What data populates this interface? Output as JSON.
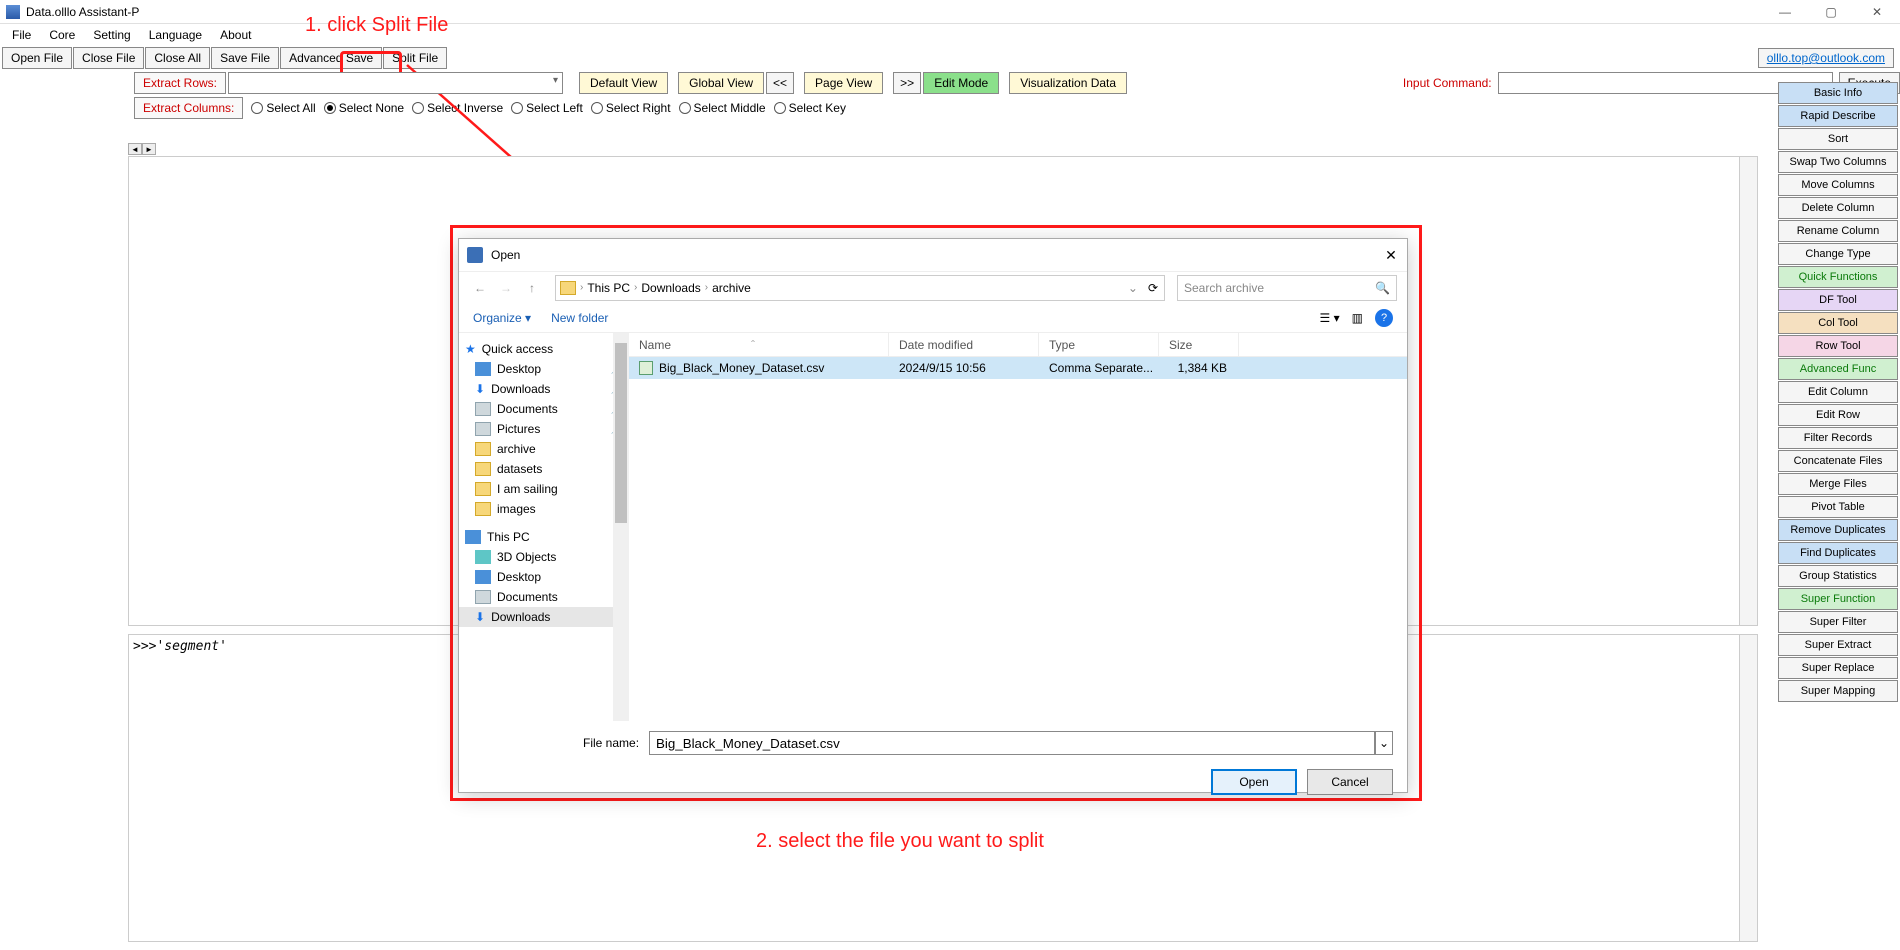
{
  "window": {
    "title": "Data.olllo Assistant-P"
  },
  "menu": {
    "file": "File",
    "core": "Core",
    "setting": "Setting",
    "language": "Language",
    "about": "About"
  },
  "toolbar": {
    "open": "Open File",
    "close": "Close File",
    "closeall": "Close All",
    "save": "Save File",
    "advsave": "Advanced Save",
    "split": "Split File"
  },
  "userlink": "olllo.top@outlook.com",
  "row2": {
    "extract_rows": "Extract Rows:",
    "default_view": "Default View",
    "global_view": "Global View",
    "prev": "<<",
    "page_view": "Page View",
    "next": ">>",
    "edit_mode": "Edit Mode",
    "viz": "Visualization Data",
    "input_cmd": "Input Command:",
    "execute": "Execute"
  },
  "row3": {
    "extract_cols": "Extract Columns:",
    "all": "Select All",
    "none": "Select None",
    "inv": "Select Inverse",
    "left": "Select Left",
    "right": "Select Right",
    "mid": "Select Middle",
    "key": "Select Key"
  },
  "sidebar": [
    {
      "label": "Basic Info",
      "cls": "c-blue"
    },
    {
      "label": "Rapid Describe",
      "cls": "c-blue"
    },
    {
      "label": "Sort",
      "cls": "c-def"
    },
    {
      "label": "Swap Two Columns",
      "cls": "c-def"
    },
    {
      "label": "Move Columns",
      "cls": "c-def"
    },
    {
      "label": "Delete Column",
      "cls": "c-def"
    },
    {
      "label": "Rename Column",
      "cls": "c-def"
    },
    {
      "label": "Change Type",
      "cls": "c-def"
    },
    {
      "label": "Quick Functions",
      "cls": "c-green"
    },
    {
      "label": "DF Tool",
      "cls": "c-purple"
    },
    {
      "label": "Col Tool",
      "cls": "c-orange"
    },
    {
      "label": "Row Tool",
      "cls": "c-pink"
    },
    {
      "label": "Advanced Func",
      "cls": "c-green"
    },
    {
      "label": "Edit Column",
      "cls": "c-def"
    },
    {
      "label": "Edit Row",
      "cls": "c-def"
    },
    {
      "label": "Filter Records",
      "cls": "c-def"
    },
    {
      "label": "Concatenate Files",
      "cls": "c-def"
    },
    {
      "label": "Merge Files",
      "cls": "c-def"
    },
    {
      "label": "Pivot Table",
      "cls": "c-def"
    },
    {
      "label": "Remove Duplicates",
      "cls": "c-blue"
    },
    {
      "label": "Find Duplicates",
      "cls": "c-blue"
    },
    {
      "label": "Group Statistics",
      "cls": "c-def"
    },
    {
      "label": "Super Function",
      "cls": "c-green"
    },
    {
      "label": "Super Filter",
      "cls": "c-def"
    },
    {
      "label": "Super Extract",
      "cls": "c-def"
    },
    {
      "label": "Super Replace",
      "cls": "c-def"
    },
    {
      "label": "Super Mapping",
      "cls": "c-def"
    }
  ],
  "console": ">>>'segment'",
  "anno": {
    "step1": "1. click Split File",
    "step2": "2. select the file you want to split"
  },
  "dialog": {
    "title": "Open",
    "path": {
      "root": "This PC",
      "p1": "Downloads",
      "p2": "archive"
    },
    "search_placeholder": "Search archive",
    "organize": "Organize",
    "newfolder": "New folder",
    "cols": {
      "name": "Name",
      "date": "Date modified",
      "type": "Type",
      "size": "Size"
    },
    "file": {
      "name": "Big_Black_Money_Dataset.csv",
      "date": "2024/9/15 10:56",
      "type": "Comma Separate...",
      "size": "1,384 KB"
    },
    "nav": {
      "quick": "Quick access",
      "desktop": "Desktop",
      "downloads": "Downloads",
      "documents": "Documents",
      "pictures": "Pictures",
      "archive": "archive",
      "datasets": "datasets",
      "sailing": "I am sailing",
      "images": "images",
      "thispc": "This PC",
      "obj3d": "3D Objects",
      "downloads2": "Downloads"
    },
    "fn_label": "File name:",
    "fn_value": "Big_Black_Money_Dataset.csv",
    "open_btn": "Open",
    "cancel_btn": "Cancel"
  }
}
